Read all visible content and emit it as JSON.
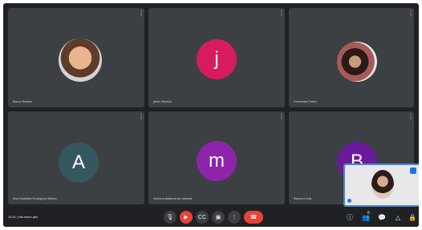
{
  "participants": [
    {
      "id": "p1",
      "type": "photo",
      "name": "Bruno Santos"
    },
    {
      "id": "p2",
      "type": "initial",
      "initial": "j",
      "color": "#d81b60",
      "name": "joice Oliveira"
    },
    {
      "id": "p3",
      "type": "photo",
      "name": "Fernanda Freire"
    },
    {
      "id": "p4",
      "type": "initial",
      "initial": "A",
      "color": "#35575f",
      "name": "Ana Gabriela Rodrigues Matos"
    },
    {
      "id": "p5",
      "type": "initial",
      "initial": "m",
      "color": "#8e24aa",
      "name": "maria madalena de oliveira"
    },
    {
      "id": "p6",
      "type": "initial",
      "initial": "B",
      "color": "#6a1b9a",
      "name": "Bianca Lima"
    }
  ],
  "bottom_bar": {
    "meeting_info": "15:31 | fak-nsmz-qbs",
    "controls": [
      {
        "name": "mic",
        "glyph": "🎙"
      },
      {
        "name": "camera",
        "glyph": "▶",
        "color": "#ea4335"
      },
      {
        "name": "captions",
        "glyph": "CC"
      },
      {
        "name": "present",
        "glyph": "▣"
      },
      {
        "name": "more",
        "glyph": "⋮"
      },
      {
        "name": "leave",
        "glyph": "☎",
        "color": "#ea4335"
      }
    ],
    "right_buttons": [
      {
        "name": "info",
        "glyph": "ⓘ"
      },
      {
        "name": "people",
        "glyph": "👥",
        "badge": "6"
      },
      {
        "name": "chat",
        "glyph": "💬"
      },
      {
        "name": "activities",
        "glyph": "△"
      },
      {
        "name": "lock",
        "glyph": "🔒"
      }
    ]
  },
  "tile_menu_glyph": "⋮"
}
